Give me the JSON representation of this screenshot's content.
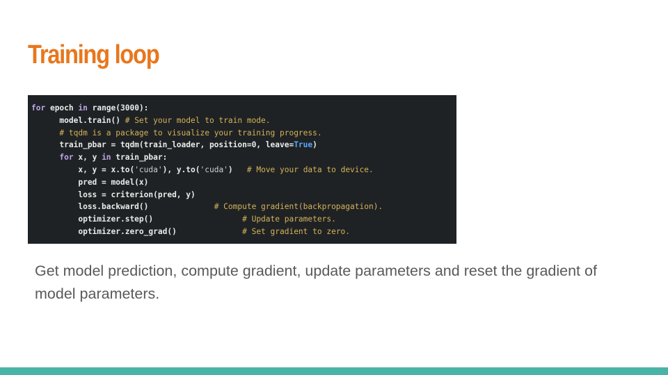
{
  "slide": {
    "title": "Training loop",
    "caption": "Get model prediction, compute gradient, update parameters and reset the gradient of model parameters."
  },
  "colors": {
    "title": "#e8771d",
    "caption": "#595959",
    "code_background": "#1e2224",
    "bottom_bar": "#4ab3a7",
    "keyword": "#bfa5e8",
    "comment": "#d6b25a",
    "boolean": "#5aa6ff"
  },
  "code": [
    [
      {
        "t": "kw",
        "v": "for"
      },
      {
        "t": "plain",
        "v": " epoch "
      },
      {
        "t": "kw",
        "v": "in"
      },
      {
        "t": "plain",
        "v": " range(3000):"
      }
    ],
    [
      {
        "t": "plain",
        "v": "      model.train() "
      },
      {
        "t": "comment",
        "v": "# Set your model to train mode."
      }
    ],
    [
      {
        "t": "plain",
        "v": "      "
      },
      {
        "t": "comment",
        "v": "# tqdm is a package to visualize your training progress."
      }
    ],
    [
      {
        "t": "plain",
        "v": "      train_pbar = tqdm(train_loader, position=0, leave="
      },
      {
        "t": "true",
        "v": "True"
      },
      {
        "t": "plain",
        "v": ")"
      }
    ],
    [
      {
        "t": "plain",
        "v": "      "
      },
      {
        "t": "kw",
        "v": "for"
      },
      {
        "t": "plain",
        "v": " x, y "
      },
      {
        "t": "kw",
        "v": "in"
      },
      {
        "t": "plain",
        "v": " train_pbar:"
      }
    ],
    [
      {
        "t": "plain",
        "v": "          x, y = x.to("
      },
      {
        "t": "string",
        "v": "'cuda'"
      },
      {
        "t": "plain",
        "v": "), y.to("
      },
      {
        "t": "string",
        "v": "'cuda'"
      },
      {
        "t": "plain",
        "v": ")   "
      },
      {
        "t": "comment",
        "v": "# Move your data to device."
      }
    ],
    [
      {
        "t": "plain",
        "v": "          pred = model(x)"
      }
    ],
    [
      {
        "t": "plain",
        "v": "          loss = criterion(pred, y)"
      }
    ],
    [
      {
        "t": "plain",
        "v": "          loss.backward()              "
      },
      {
        "t": "comment",
        "v": "# Compute gradient(backpropagation)."
      }
    ],
    [
      {
        "t": "plain",
        "v": "          optimizer.step()                   "
      },
      {
        "t": "comment",
        "v": "# Update parameters."
      }
    ],
    [
      {
        "t": "plain",
        "v": "          optimizer.zero_grad()              "
      },
      {
        "t": "comment",
        "v": "# Set gradient to zero."
      }
    ]
  ]
}
